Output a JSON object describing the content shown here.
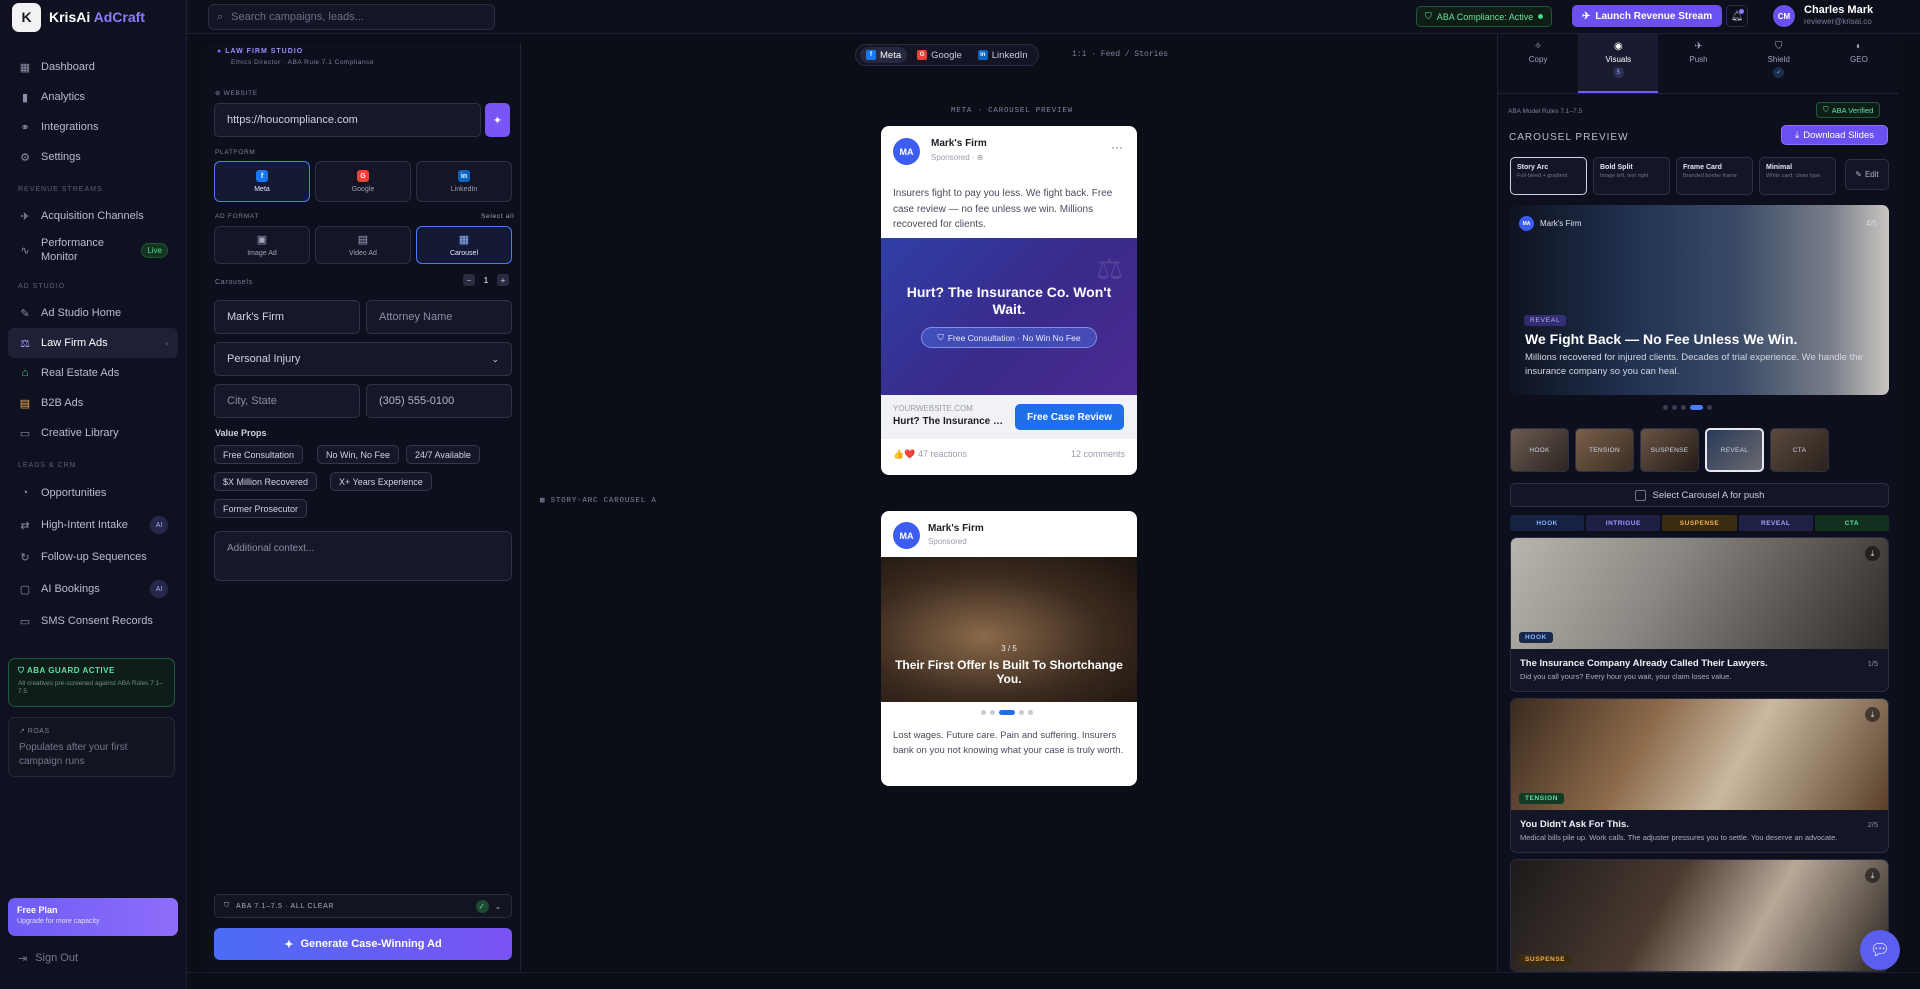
{
  "brand": {
    "name": "KrisAi",
    "accent_name": "AdCraft",
    "logo_letter": "K"
  },
  "sidebar": {
    "main": [
      {
        "label": "Dashboard",
        "icon": "▦"
      },
      {
        "label": "Analytics",
        "icon": "📊"
      },
      {
        "label": "Integrations",
        "icon": "⚭"
      },
      {
        "label": "Settings",
        "icon": "⚙"
      }
    ],
    "revenue_title": "REVENUE STREAMS",
    "revenue": [
      {
        "label": "Acquisition Channels",
        "icon": "✈"
      },
      {
        "label": "Performance Monitor",
        "icon": "∿",
        "badge": "Live"
      }
    ],
    "studio_title": "AD STUDIO",
    "studio": [
      {
        "label": "Ad Studio Home",
        "icon": "✎"
      },
      {
        "label": "Law Firm Ads",
        "icon": "⚖"
      },
      {
        "label": "Real Estate Ads",
        "icon": "⌂"
      },
      {
        "label": "B2B Ads",
        "icon": "▤"
      },
      {
        "label": "Creative Library",
        "icon": "▭"
      }
    ],
    "crm_title": "LEADS & CRM",
    "crm": [
      {
        "label": "Opportunities",
        "icon": "◔"
      },
      {
        "label": "High-Intent Intake",
        "icon": "⇄",
        "badge": "AI"
      },
      {
        "label": "Follow-up Sequences",
        "icon": "↻"
      },
      {
        "label": "AI Bookings",
        "icon": "▢",
        "badge": "AI"
      },
      {
        "label": "SMS Consent Records",
        "icon": "▭"
      }
    ],
    "guard_title": "ABA GUARD ACTIVE",
    "guard_desc": "All creatives pre-screened against ABA Rules 7.1–7.5",
    "roas_title": "↗ ROAS",
    "roas_desc": "Populates after your first campaign runs",
    "plan_title": "Free Plan",
    "plan_desc": "Upgrade for more capacity",
    "signout": "Sign Out"
  },
  "topbar": {
    "search_placeholder": "Search campaigns, leads...",
    "aba_status": "ABA Compliance: Active",
    "launch": "Launch Revenue Stream",
    "user_initials": "CM",
    "user_name": "Charles Mark",
    "user_email": "reviewer@krisai.co"
  },
  "studio": {
    "title": "LAW FIRM STUDIO",
    "subtitle": "Ethics Director · ABA Rule 7.1 Compliance",
    "website_label": "WEBSITE",
    "website_value": "https://houcompliance.com",
    "platform_label": "PLATFORM",
    "platforms": [
      {
        "label": "Meta",
        "letter": "f",
        "color": "#1877f2"
      },
      {
        "label": "Google",
        "letter": "G",
        "color": "#ea4335"
      },
      {
        "label": "LinkedIn",
        "letter": "in",
        "color": "#0a66c2"
      }
    ],
    "format_label": "AD FORMAT",
    "select_all": "Select all",
    "formats": [
      "Image Ad",
      "Video Ad",
      "Carousel"
    ],
    "carousels_label": "Carousels",
    "carousels_count": "1",
    "firm_name": "Mark's Firm",
    "attorney_placeholder": "Attorney Name",
    "practice_area": "Personal Injury",
    "city_placeholder": "City, State",
    "phone_placeholder": "(305) 555-0100",
    "value_props_label": "Value Props",
    "value_props": [
      "Free Consultation",
      "No Win, No Fee",
      "24/7 Available",
      "$X Million Recovered",
      "X+ Years Experience",
      "Former Prosecutor"
    ],
    "context_placeholder": "Additional context...",
    "aba_footer": "ABA 7.1–7.5 · ALL CLEAR",
    "generate": "Generate Case-Winning Ad"
  },
  "preview": {
    "tabs": [
      "Meta",
      "Google",
      "LinkedIn"
    ],
    "ratio": "1:1 · Feed / Stories",
    "caption1": "META · CAROUSEL PREVIEW",
    "caption2": "STORY-ARC CAROUSEL A",
    "ad1": {
      "initials": "MA",
      "firm": "Mark's Firm",
      "sponsored": "Sponsored · ⊕",
      "copy": "Insurers fight to pay you less. We fight back. Free case review — no fee unless we win. Millions recovered for clients.",
      "headline": "Hurt? The Insurance Co. Won't Wait.",
      "pill": "Free Consultation · No Win No Fee",
      "url": "YOURWEBSITE.COM",
      "short_headline": "Hurt? The Insurance Co. Won't Wait.",
      "cta": "Free Case Review",
      "reactions": "47 reactions",
      "comments": "12 comments"
    },
    "ad2": {
      "initials": "MA",
      "firm": "Mark's Firm",
      "sponsored": "Sponsored",
      "counter": "3 / 5",
      "headline": "Their First Offer Is Built To Shortchange You.",
      "copy": "Lost wages. Future care. Pain and suffering. Insurers bank on you not knowing what your case is truly worth.",
      "active_slide": 3,
      "slide_count": 5
    }
  },
  "visuals": {
    "tabs": [
      {
        "label": "Copy",
        "icon": "✧"
      },
      {
        "label": "Visuals",
        "icon": "◉",
        "sub": "5"
      },
      {
        "label": "Push",
        "icon": "✈"
      },
      {
        "label": "Shield",
        "icon": "⛉",
        "sub": "✓"
      },
      {
        "label": "GEO",
        "icon": "◐"
      }
    ],
    "rules": "ABA Model Rules 7.1–7.5",
    "verified": "ABA Verified",
    "title": "CAROUSEL PREVIEW",
    "download": "Download Slides",
    "styles": [
      {
        "t": "Story Arc",
        "d": "Full-bleed + gradient"
      },
      {
        "t": "Bold Split",
        "d": "Image left, text right"
      },
      {
        "t": "Frame Card",
        "d": "Branded border frame"
      },
      {
        "t": "Minimal",
        "d": "White card, clean type"
      }
    ],
    "edit": "Edit",
    "big": {
      "initials": "MA",
      "firm": "Mark's Firm",
      "count": "4/5",
      "tag": "REVEAL",
      "headline": "We Fight Back — No Fee Unless We Win.",
      "desc": "Millions recovered for injured clients. Decades of trial experience. We handle the insurance company so you can heal.",
      "active_slide": 4,
      "slide_count": 5
    },
    "thumbs": [
      "HOOK",
      "TENSION",
      "SUSPENSE",
      "REVEAL",
      "CTA"
    ],
    "select_a": "Select Carousel A for push",
    "arc": [
      {
        "label": "HOOK",
        "bg": "#16223f",
        "fg": "#7fb3ff"
      },
      {
        "label": "INTRIGUE",
        "bg": "#1d1f44",
        "fg": "#9a9dff"
      },
      {
        "label": "SUSPENSE",
        "bg": "#3a2b12",
        "fg": "#f0b04a"
      },
      {
        "label": "REVEAL",
        "bg": "#1e2045",
        "fg": "#a9a4ff"
      },
      {
        "label": "CTA",
        "bg": "#12301f",
        "fg": "#5ee0a0"
      }
    ],
    "scenes": [
      {
        "tag": "HOOK",
        "title": "The Insurance Company Already Called Their Lawyers.",
        "desc": "Did you call yours? Every hour you wait, your claim loses value.",
        "count": "1/5"
      },
      {
        "tag": "TENSION",
        "title": "You Didn't Ask For This.",
        "desc": "Medical bills pile up. Work calls. The adjuster pressures you to settle. You deserve an advocate.",
        "count": "2/5"
      },
      {
        "tag": "SUSPENSE",
        "title": "",
        "desc": "",
        "count": ""
      }
    ]
  }
}
